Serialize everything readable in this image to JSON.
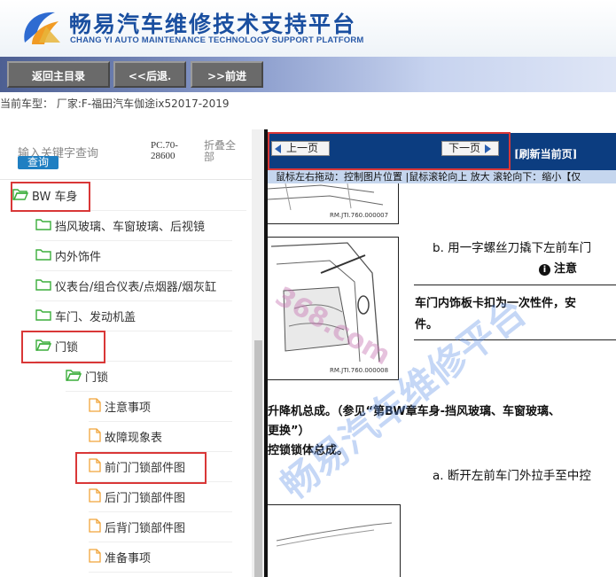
{
  "header": {
    "title": "畅易汽车维修技术支持平台",
    "subtitle": "CHANG YI AUTO MAINTENANCE TECHNOLOGY SUPPORT PLATFORM"
  },
  "toolbar": {
    "home_label": "返回主目录",
    "back_label": "<<后退.",
    "forward_label": ">>前进"
  },
  "current_car": "当前车型：  厂家:F-福田汽车伽途ix52017-2019",
  "search": {
    "hint": "输入关键字查询",
    "button_label": "查询",
    "pc_label": "PC.70-28600",
    "collapse_label": "折叠全部"
  },
  "tree": [
    {
      "label": "BW 车身",
      "icon": "folder-open-icon",
      "highlighted": true
    },
    {
      "label": "挡风玻璃、车窗玻璃、后视镜",
      "icon": "folder-icon"
    },
    {
      "label": "内外饰件",
      "icon": "folder-icon"
    },
    {
      "label": "仪表台/组合仪表/点烟器/烟灰缸",
      "icon": "folder-icon"
    },
    {
      "label": "车门、发动机盖",
      "icon": "folder-icon"
    },
    {
      "label": "门锁",
      "icon": "folder-open-icon",
      "highlighted": true
    },
    {
      "label": "门锁",
      "icon": "folder-open-icon"
    },
    {
      "label": "注意事项",
      "icon": "document-icon"
    },
    {
      "label": "故障现象表",
      "icon": "document-icon"
    },
    {
      "label": "前门门锁部件图",
      "icon": "document-icon",
      "highlighted": true
    },
    {
      "label": "后门门锁部件图",
      "icon": "document-icon"
    },
    {
      "label": "后背门锁部件图",
      "icon": "document-icon"
    },
    {
      "label": "准备事项",
      "icon": "document-icon"
    }
  ],
  "viewer": {
    "prev_label": "上一页",
    "next_label": "下一页",
    "refresh_label": "[刷新当前页]",
    "tip": "鼠标左右拖动：控制图片位置 |鼠标滚轮向上 放大  滚轮向下：缩小【仅"
  },
  "document": {
    "fig1_code": "RM.JTI.760.000007",
    "fig2_code": "RM.JTI.760.000008",
    "step_b": "b. 用一字螺丝刀撬下左前车门",
    "note_title": "注意",
    "note_text_1": "车门内饰板卡扣为一次性件，安",
    "note_text_2": "件。",
    "para_1": "升降机总成。（参见“第BW章车身-挡风玻璃、车窗玻璃、",
    "para_2": "更换”）",
    "para_3": "控锁锁体总成。",
    "step_a": "a. 断开左前车门外拉手至中控",
    "watermark": "畅易汽车维修平台",
    "watermark_url": "368.com"
  },
  "colors": {
    "highlight": "#d93737",
    "brand_blue": "#1a4fa0",
    "navbar": "#0c3d80",
    "folder_green": "#3cae3c",
    "doc_orange": "#f0a53a"
  }
}
